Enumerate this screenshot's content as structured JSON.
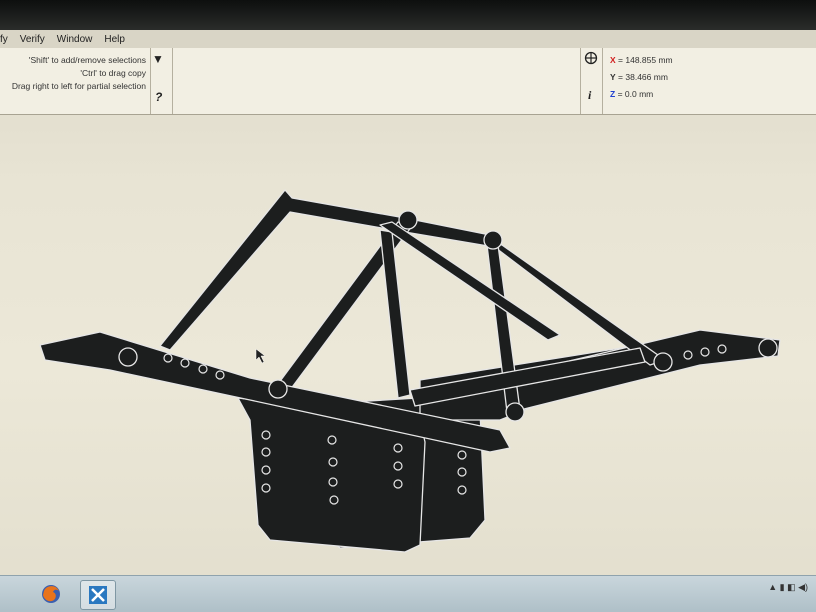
{
  "menu": {
    "items": [
      "fy",
      "Verify",
      "Window",
      "Help"
    ]
  },
  "selection_hints": {
    "line1": "'Shift' to add/remove selections",
    "line2": "'Ctrl' to drag copy",
    "line3": "Drag right to left for partial selection",
    "dropdown_icon": "triangle-down-icon",
    "help_icon": "question-mark-icon"
  },
  "coordinates": {
    "snap_icon": "crosshair-circle-icon",
    "info_icon": "info-icon",
    "x_label": "X",
    "x_value": "= 148.855 mm",
    "y_label": "Y",
    "y_value": "= 38.466 mm",
    "z_label": "Z",
    "z_value": "= 0.0 mm",
    "x_color": "#d22020",
    "y_color": "#333333",
    "z_color": "#2040d0"
  },
  "model": {
    "name": "rock crawler chassis frame",
    "color": "#1c1e1e",
    "edge_color": "#e8e8e8"
  },
  "taskbar": {
    "apps": [
      {
        "name": "firefox-icon"
      },
      {
        "name": "cad-app-icon"
      }
    ]
  }
}
